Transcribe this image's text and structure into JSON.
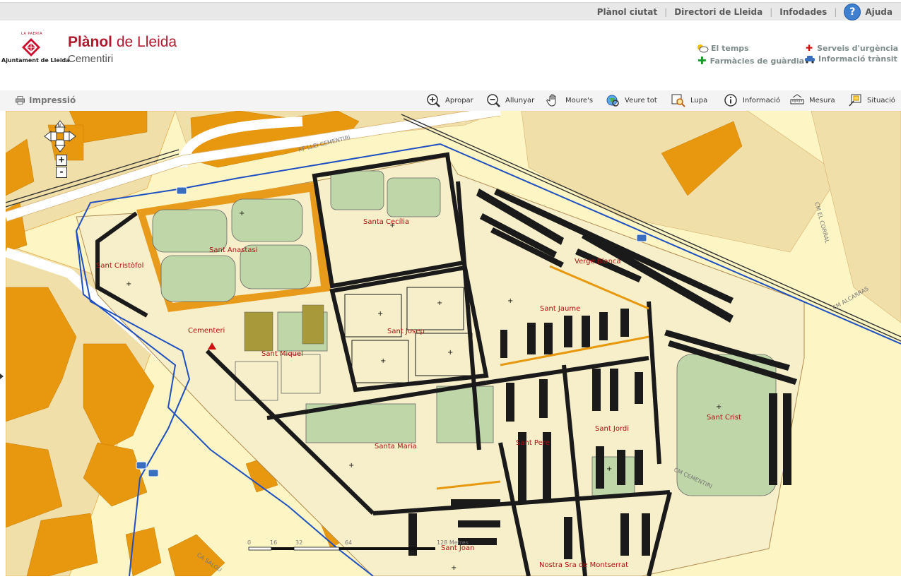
{
  "top_nav": {
    "links": [
      "Plànol ciutat",
      "Directori de Lleida",
      "Infodades"
    ],
    "help": "Ajuda"
  },
  "logo": {
    "top": "LA PAERIA",
    "bottom": "Ajuntament de Lleida"
  },
  "title": {
    "part1": "Plànol",
    "part2": " de Lleida",
    "subtitle": "Cementiri"
  },
  "services": {
    "weather": "El temps",
    "pharmacies": "Farmàcies de guàrdia",
    "emergency": "Serveis d'urgència",
    "traffic": "Informació trànsit"
  },
  "toolbar": {
    "print": "Impressió",
    "tools": [
      "Apropar",
      "Allunyar",
      "Moure's",
      "Veure tot",
      "Lupa",
      "Informació",
      "Mesura",
      "Situació"
    ]
  },
  "map": {
    "zoom_in": "+",
    "zoom_out": "-",
    "pan_north": "N",
    "labels": [
      "Santa Cecília",
      "Sant Anastasi",
      "Sant Cristòfol",
      "Verge Blanca",
      "Sant Jaume",
      "Sant Josep",
      "Cementeri",
      "Sant Miquel",
      "Sant Crist",
      "Sant Jordi",
      "Sant Pere",
      "Santa Maria",
      "Sant Joan",
      "Nostra Sra de Montserrat"
    ],
    "roads": [
      "RF LLEI CEMENTIRI",
      "CM EL CORRAL",
      "CM ALCARRAS",
      "CM CEMENTIRI",
      "CA SALOU"
    ],
    "scale": {
      "ticks": [
        "0",
        "16",
        "32",
        "64"
      ],
      "unit": "128 Metres"
    }
  }
}
